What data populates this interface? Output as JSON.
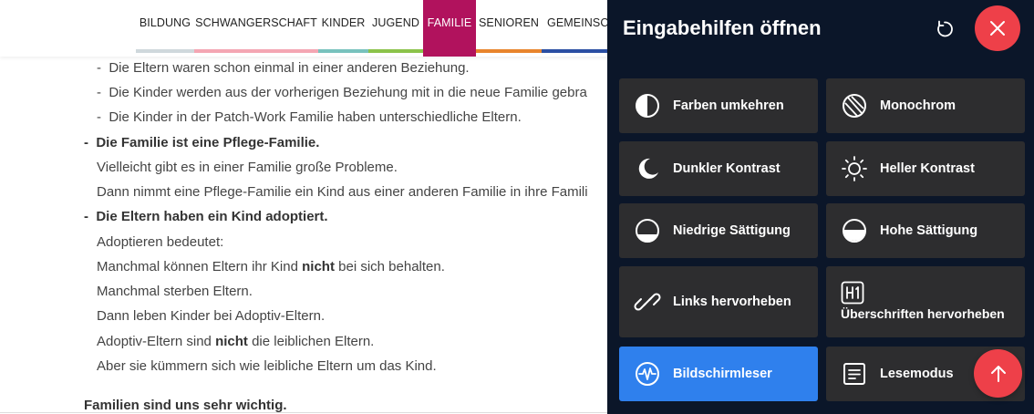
{
  "nav": {
    "items": [
      {
        "label": "BILDUNG",
        "color": "#cfd8dc",
        "active": false
      },
      {
        "label": "SCHWANGERSCHAFT",
        "color": "#f4a6b3",
        "active": false
      },
      {
        "label": "KINDER",
        "color": "#78c2bd",
        "active": false
      },
      {
        "label": "JUGEND",
        "color": "#8bc34a",
        "active": false
      },
      {
        "label": "FAMILIE",
        "color": "#b1125d",
        "active": true
      },
      {
        "label": "SENIOREN",
        "color": "#e8842c",
        "active": false
      },
      {
        "label": "GEMEINSCH",
        "color": "#2b4fa3",
        "active": false
      }
    ]
  },
  "article": {
    "sub_items": [
      "Die Eltern waren schon einmal in einer anderen Beziehung.",
      "Die Kinder werden aus der vorherigen Beziehung mit in die neue Familie gebra",
      "Die Kinder in der Patch-Work Familie haben unterschiedliche Eltern."
    ],
    "pflege_heading": "Die Familie ist eine Pflege-Familie.",
    "pflege_text_1": "Vielleicht gibt es in einer Familie große Probleme.",
    "pflege_text_2": "Dann nimmt eine Pflege-Familie ein Kind aus einer anderen Familie in ihre Famili",
    "adopt_heading": "Die Eltern haben ein Kind adoptiert.",
    "adopt_text_1": "Adoptieren bedeutet:",
    "adopt_text_2_pre": "Manchmal können Eltern ihr Kind ",
    "adopt_text_2_bold": "nicht",
    "adopt_text_2_post": " bei sich behalten.",
    "adopt_text_3": "Manchmal sterben Eltern.",
    "adopt_text_4": "Dann leben Kinder bei Adoptiv-Eltern.",
    "adopt_text_5_pre": "Adoptiv-Eltern sind ",
    "adopt_text_5_bold": "nicht",
    "adopt_text_5_post": " die leiblichen Eltern.",
    "adopt_text_6": "Aber sie kümmern sich wie leibliche Eltern um das Kind.",
    "closing": "Familien sind uns sehr wichtig.",
    "dash": "-"
  },
  "panel": {
    "title": "Eingabehilfen öffnen",
    "tiles": [
      {
        "label": "Farben umkehren",
        "icon": "invert-colors-icon"
      },
      {
        "label": "Monochrom",
        "icon": "monochrome-icon"
      },
      {
        "label": "Dunkler Kontrast",
        "icon": "moon-icon"
      },
      {
        "label": "Heller Kontrast",
        "icon": "sun-icon"
      },
      {
        "label": "Niedrige Sättigung",
        "icon": "low-saturation-icon"
      },
      {
        "label": "Hohe Sättigung",
        "icon": "high-saturation-icon"
      },
      {
        "label": "Links hervorheben",
        "icon": "link-icon"
      },
      {
        "label": "Überschriften hervorheben",
        "icon": "h1-icon"
      },
      {
        "label": "Bildschirmleser",
        "icon": "screen-reader-icon",
        "active": true
      },
      {
        "label": "Lesemodus",
        "icon": "reading-mode-icon"
      }
    ]
  },
  "colors": {
    "accent_red": "#ee4049",
    "active_blue": "#2f80ed",
    "panel_bg": "#0b1629",
    "tile_bg": "#2d2d2f"
  }
}
